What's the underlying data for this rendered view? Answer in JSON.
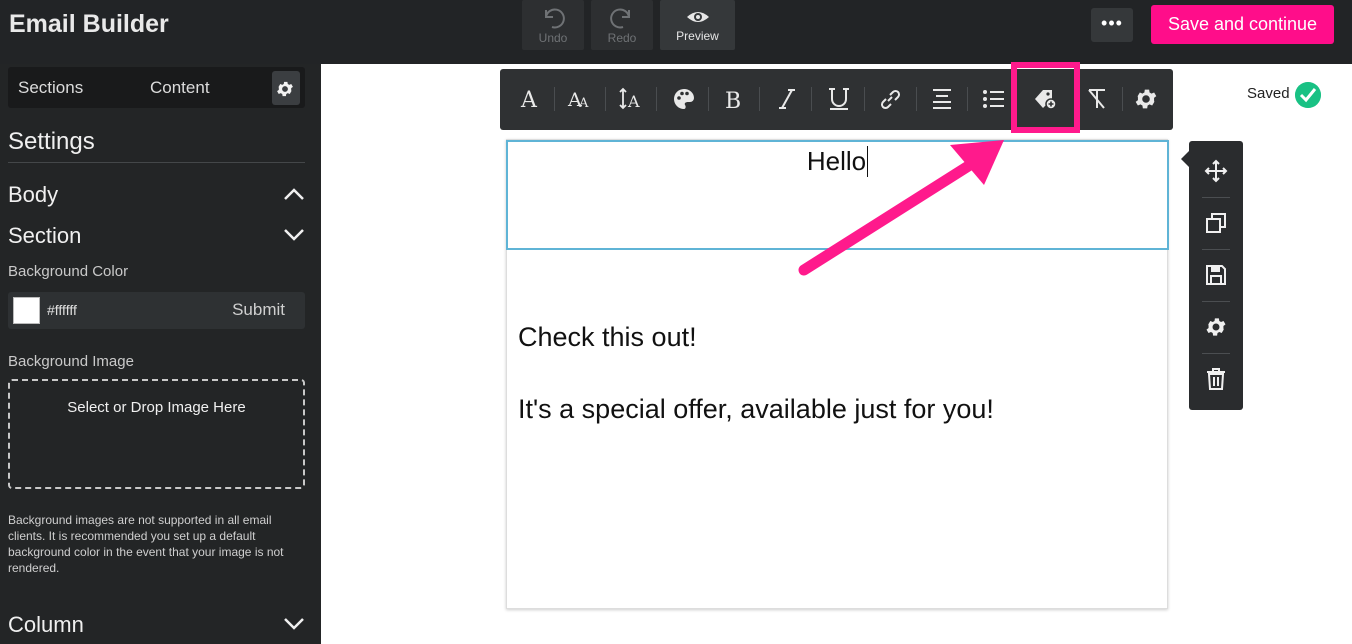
{
  "header": {
    "app_title": "Email Builder",
    "undo_label": "Undo",
    "redo_label": "Redo",
    "preview_label": "Preview",
    "more_label": "•••",
    "save_label": "Save and continue"
  },
  "sidebar": {
    "tabs": [
      "Sections",
      "Content"
    ],
    "settings_heading": "Settings",
    "body_label": "Body",
    "section_label": "Section",
    "background_color_label": "Background Color",
    "background_color_value": "#ffffff",
    "submit_label": "Submit",
    "background_image_label": "Background Image",
    "dropzone_label": "Select or Drop Image Here",
    "note": "Background images are not supported in all email clients. It is recommended you set up a default background color in the event that your image is not rendered.",
    "column_label": "Column"
  },
  "editor": {
    "status": "Saved",
    "hello_text": "Hello",
    "line1": "Check this out!",
    "line2": "It's a special offer, available just for you!"
  },
  "colors": {
    "accent": "#ff0d8a",
    "saved_check": "#19c184",
    "selection_border": "#5fb4d6"
  },
  "toolbar_icons": [
    "font-icon",
    "font-size-icon",
    "line-height-icon",
    "color-palette-icon",
    "bold-icon",
    "italic-icon",
    "underline-icon",
    "link-icon",
    "align-icon",
    "list-icon",
    "merge-tag-icon",
    "clear-format-icon",
    "gear-icon"
  ],
  "side_tool_icons": [
    "move-icon",
    "duplicate-icon",
    "save-icon",
    "gear-icon",
    "trash-icon"
  ]
}
